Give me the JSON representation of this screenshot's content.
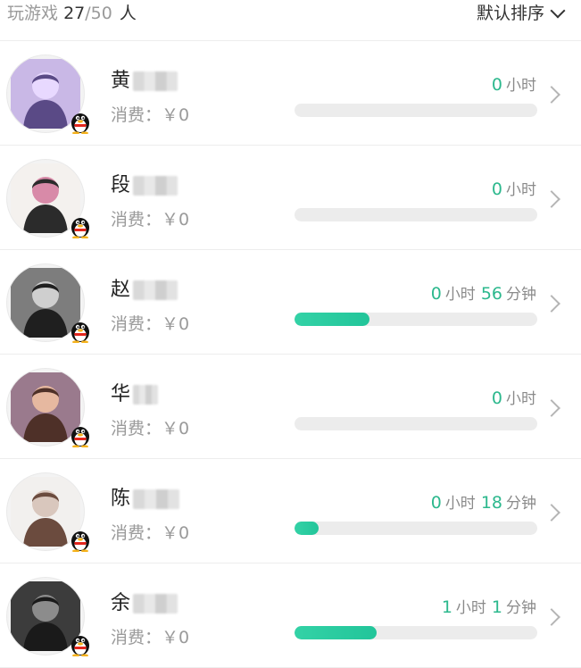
{
  "header": {
    "label": "玩游戏",
    "count": "27",
    "separator": "/",
    "total": "50",
    "unit": "人",
    "sort_label": "默认排序"
  },
  "players": [
    {
      "name": "黄",
      "spend": "消费：￥0",
      "time": [
        {
          "value": "0",
          "unit": "小时"
        }
      ],
      "progress": 0,
      "avatar": {
        "bg": "#c9b8e6",
        "fg": "#5a4a86",
        "accent": "#e8d9ff"
      }
    },
    {
      "name": "段",
      "spend": "消费：￥0",
      "time": [
        {
          "value": "0",
          "unit": "小时"
        }
      ],
      "progress": 0,
      "avatar": {
        "bg": "#f4f1ee",
        "fg": "#2b2b2b",
        "accent": "#d88aa8"
      }
    },
    {
      "name": "赵",
      "spend": "消费：￥0",
      "time": [
        {
          "value": "0",
          "unit": "小时"
        },
        {
          "value": "56",
          "unit": "分钟"
        }
      ],
      "progress": 0.31,
      "avatar": {
        "bg": "#7d7d7d",
        "fg": "#1f1f1f",
        "accent": "#cfcfcf"
      }
    },
    {
      "name": "华",
      "spend": "消费：￥0",
      "time": [
        {
          "value": "0",
          "unit": "小时"
        }
      ],
      "progress": 0,
      "avatar": {
        "bg": "#9a7a8d",
        "fg": "#4e3028",
        "accent": "#e6b8a0"
      }
    },
    {
      "name": "陈",
      "spend": "消费：￥0",
      "time": [
        {
          "value": "0",
          "unit": "小时"
        },
        {
          "value": "18",
          "unit": "分钟"
        }
      ],
      "progress": 0.1,
      "avatar": {
        "bg": "#f2f0ee",
        "fg": "#6b4b3e",
        "accent": "#d9c7bd"
      }
    },
    {
      "name": "余",
      "spend": "消费：￥0",
      "time": [
        {
          "value": "1",
          "unit": "小时"
        },
        {
          "value": "1",
          "unit": "分钟"
        }
      ],
      "progress": 0.34,
      "avatar": {
        "bg": "#3c3c3c",
        "fg": "#1a1a1a",
        "accent": "#8c8c8c"
      }
    }
  ]
}
